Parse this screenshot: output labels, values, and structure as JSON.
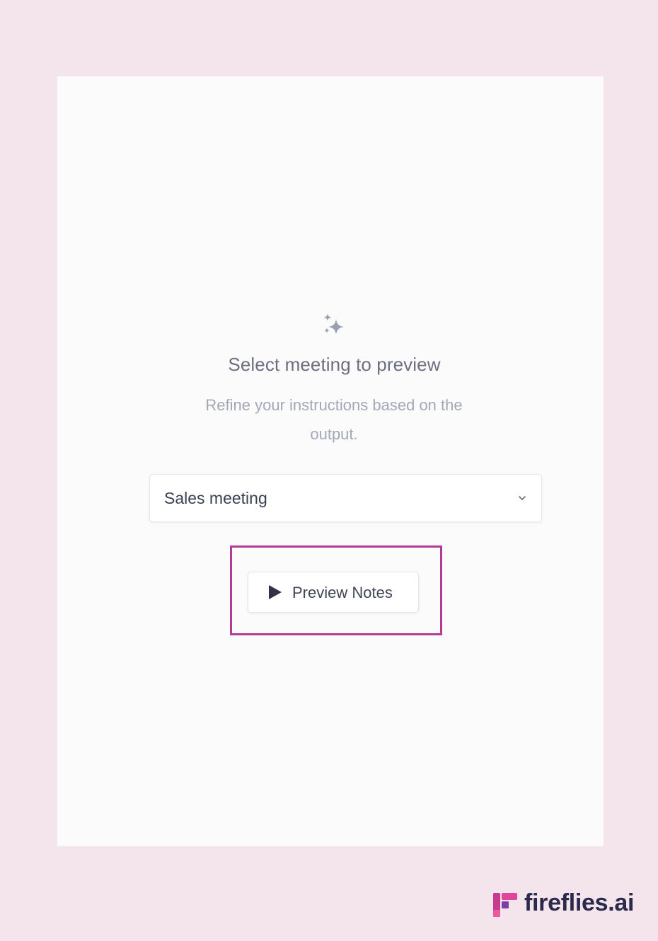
{
  "empty_state": {
    "icon": "sparkle-icon",
    "title": "Select meeting to preview",
    "subtitle": "Refine your instructions based on the output."
  },
  "meeting_select": {
    "selected_value": "Sales meeting",
    "icon": "chevron-down-icon"
  },
  "preview_button": {
    "label": "Preview Notes",
    "icon": "play-icon"
  },
  "branding": {
    "name": "fireflies.ai",
    "logo": "fireflies-logo"
  },
  "colors": {
    "background": "#f4e5ec",
    "panel": "#fbfbfc",
    "highlight": "#b33b93",
    "brand_text": "#2b2a4c"
  }
}
